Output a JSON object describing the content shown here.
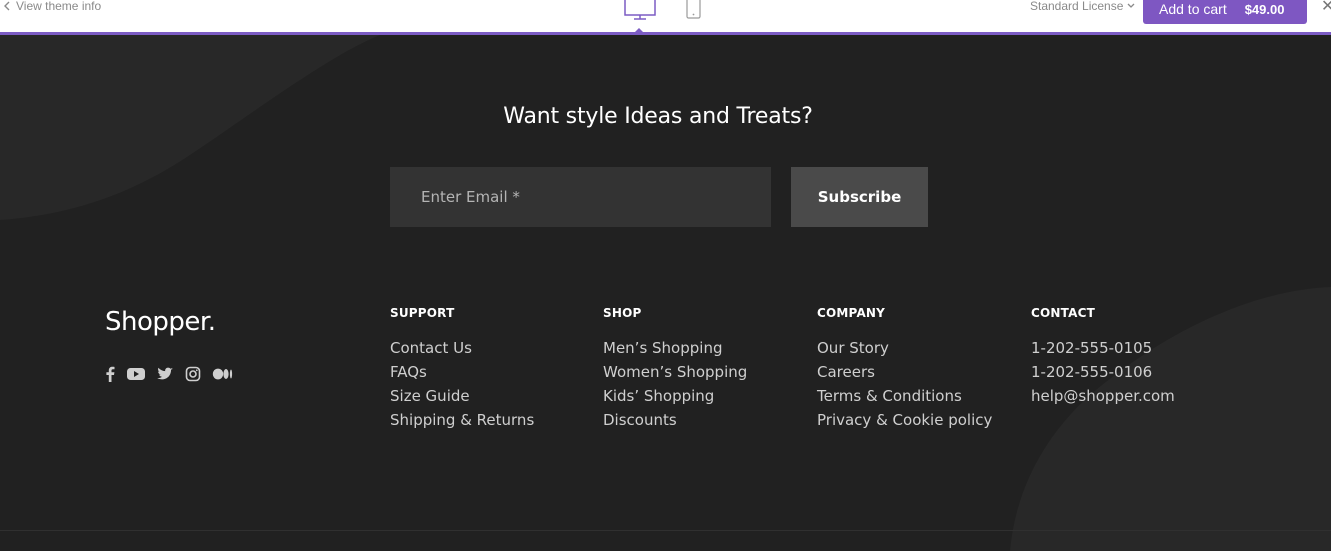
{
  "topbar": {
    "view_theme_info": "View theme info",
    "license": "Standard License",
    "add_to_cart": "Add to cart",
    "price": "$49.00",
    "accent_color": "#7e57c2",
    "selected_device": "desktop"
  },
  "newsletter": {
    "title": "Want style Ideas and Treats?",
    "email_placeholder": "Enter Email *",
    "subscribe_label": "Subscribe"
  },
  "brand": {
    "name": "Shopper.",
    "socials": [
      "facebook-icon",
      "youtube-icon",
      "twitter-icon",
      "instagram-icon",
      "medium-icon"
    ]
  },
  "columns": {
    "support": {
      "title": "SUPPORT",
      "links": [
        "Contact Us",
        "FAQs",
        "Size Guide",
        "Shipping & Returns"
      ]
    },
    "shop": {
      "title": "SHOP",
      "links": [
        "Men’s Shopping",
        "Women’s Shopping",
        "Kids’ Shopping",
        "Discounts"
      ]
    },
    "company": {
      "title": "COMPANY",
      "links": [
        "Our Story",
        "Careers",
        "Terms & Conditions",
        "Privacy & Cookie policy"
      ]
    },
    "contact": {
      "title": "CONTACT",
      "links": [
        "1-202-555-0105",
        "1-202-555-0106",
        "help@shopper.com"
      ]
    }
  }
}
